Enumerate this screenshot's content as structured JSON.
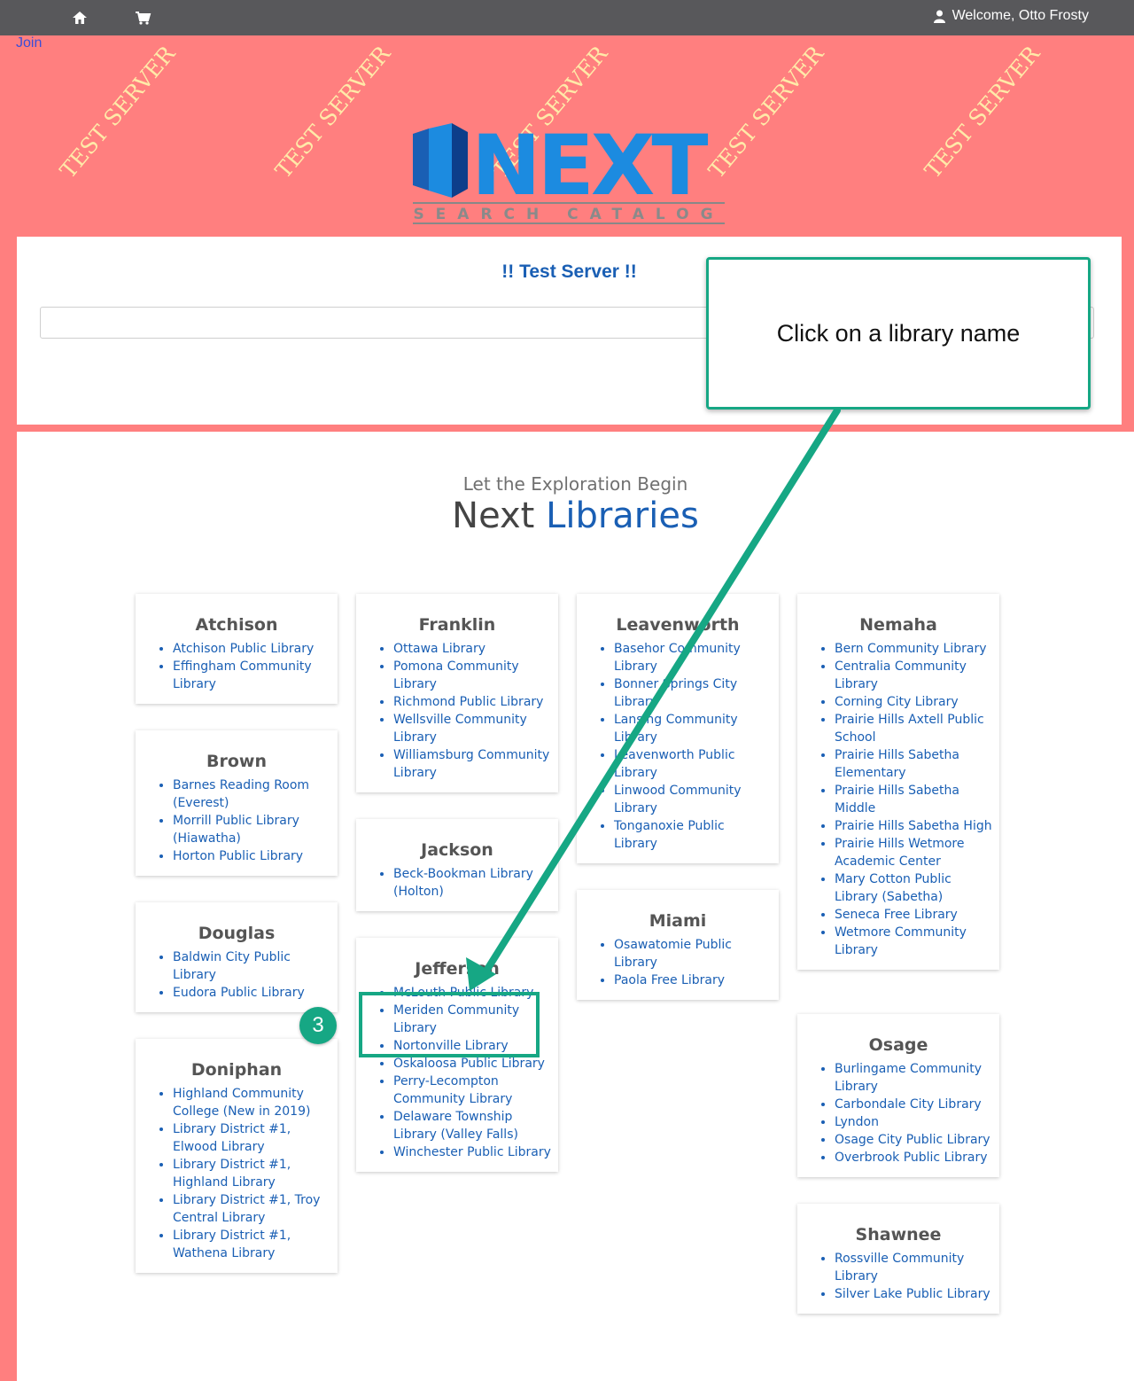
{
  "topbar": {
    "home_icon": "home-icon",
    "cart_icon": "cart-icon",
    "user_icon": "user-icon",
    "welcome": "Welcome, Otto Frosty"
  },
  "join_label": "Join",
  "watermark": "TEST SERVER",
  "logo": {
    "word": "NEXT",
    "tagline": "SEARCH CATALOG"
  },
  "search": {
    "title": "!! Test Server !!",
    "placeholder": ""
  },
  "hero": {
    "subtitle": "Let the Exploration Begin",
    "title_a": "Next",
    "title_b": "Libraries"
  },
  "callout": {
    "text": "Click on a library name"
  },
  "step": "3",
  "colors": {
    "page_bg": "#ff7f7f",
    "topbar": "#58585b",
    "accent": "#16a784",
    "link": "#1a5fb4"
  },
  "counties": {
    "atchison": {
      "name": "Atchison",
      "libs": [
        "Atchison Public Library",
        "Effingham Community Library"
      ]
    },
    "brown": {
      "name": "Brown",
      "libs": [
        "Barnes Reading Room (Everest)",
        "Morrill Public Library (Hiawatha)",
        "Horton Public Library"
      ]
    },
    "douglas": {
      "name": "Douglas",
      "libs": [
        "Baldwin City Public Library",
        "Eudora Public Library"
      ]
    },
    "doniphan": {
      "name": "Doniphan",
      "libs": [
        "Highland Community College (New in 2019)",
        "Library District #1, Elwood Library",
        "Library District #1, Highland Library",
        "Library District #1, Troy Central Library",
        "Library District #1, Wathena Library"
      ]
    },
    "franklin": {
      "name": "Franklin",
      "libs": [
        "Ottawa Library",
        "Pomona Community Library",
        "Richmond Public Library",
        "Wellsville Community Library",
        "Williamsburg Community Library"
      ]
    },
    "jackson": {
      "name": "Jackson",
      "libs": [
        "Beck-Bookman Library (Holton)"
      ]
    },
    "jefferson": {
      "name": "Jefferson",
      "libs": [
        "McLouth Public Library",
        "Meriden Community Library",
        "Nortonville Library",
        "Oskaloosa Public Library",
        "Perry-Lecompton Community Library",
        "Delaware Township Library (Valley Falls)",
        "Winchester Public Library"
      ]
    },
    "leavenworth": {
      "name": "Leavenworth",
      "libs": [
        "Basehor Community Library",
        "Bonner Springs City Library",
        "Lansing Community Library",
        "Leavenworth Public Library",
        "Linwood Community Library",
        "Tonganoxie Public Library"
      ]
    },
    "miami": {
      "name": "Miami",
      "libs": [
        "Osawatomie Public Library",
        "Paola Free Library"
      ]
    },
    "nemaha": {
      "name": "Nemaha",
      "libs": [
        "Bern Community Library",
        "Centralia Community Library",
        "Corning City Library",
        "Prairie Hills Axtell Public School",
        "Prairie Hills Sabetha Elementary",
        "Prairie Hills Sabetha Middle",
        "Prairie Hills Sabetha High",
        "Prairie Hills Wetmore Academic Center",
        "Mary Cotton Public Library (Sabetha)",
        "Seneca Free Library",
        "Wetmore Community Library"
      ]
    },
    "osage": {
      "name": "Osage",
      "libs": [
        "Burlingame Community Library",
        "Carbondale City Library",
        "Lyndon",
        "Osage City Public Library",
        "Overbrook Public Library"
      ]
    },
    "shawnee": {
      "name": "Shawnee",
      "libs": [
        "Rossville Community Library",
        "Silver Lake Public Library"
      ]
    }
  }
}
